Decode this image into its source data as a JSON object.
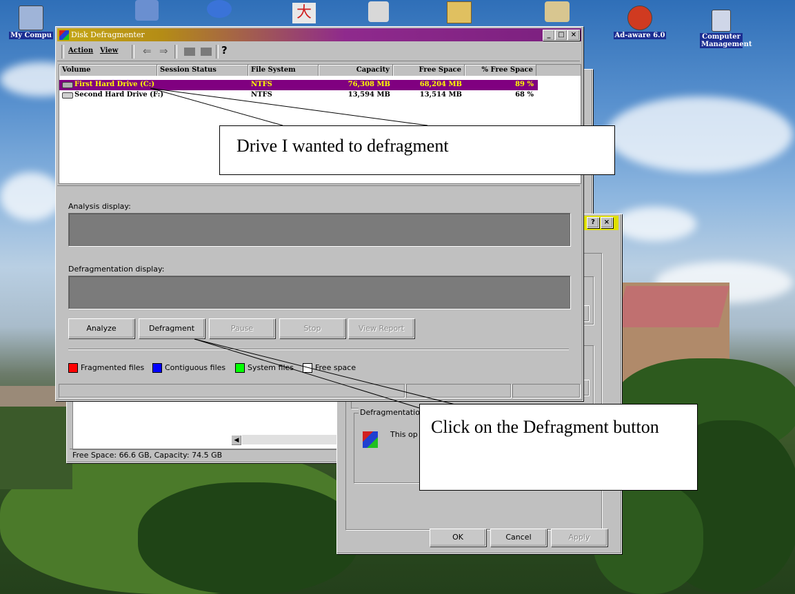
{
  "desktop": {
    "icons": [
      {
        "name": "my-computer",
        "label": "My Compu"
      },
      {
        "name": "ad-aware",
        "label": "Ad-aware 6.0"
      },
      {
        "name": "computer-management",
        "label": "Computer Management"
      }
    ]
  },
  "defrag_window": {
    "title": "Disk Defragmenter",
    "menu": {
      "action": "Action",
      "view": "View"
    },
    "columns": [
      "Volume",
      "Session Status",
      "File System",
      "Capacity",
      "Free Space",
      "% Free Space"
    ],
    "rows": [
      {
        "volume": "First Hard Drive (C:)",
        "status": "",
        "fs": "NTFS",
        "capacity": "76,308 MB",
        "free": "68,204 MB",
        "pct": "89 %"
      },
      {
        "volume": "Second Hard Drive (F:)",
        "status": "",
        "fs": "NTFS",
        "capacity": "13,594 MB",
        "free": "13,514 MB",
        "pct": "68 %"
      }
    ],
    "analysis_label": "Analysis display:",
    "defrag_label": "Defragmentation display:",
    "buttons": {
      "analyze": "Analyze",
      "defragment": "Defragment",
      "pause": "Pause",
      "stop": "Stop",
      "view_report": "View Report"
    },
    "legend": {
      "fragmented": "Fragmented files",
      "contiguous": "Contiguous files",
      "system": "System files",
      "free": "Free space"
    },
    "colors": {
      "fragmented": "#ff0000",
      "contiguous": "#0000ff",
      "system": "#00ff00",
      "free": "#ffffff"
    }
  },
  "properties_window": {
    "status_text": "Free Space: 66.6 GB, Capacity: 74.5 GB",
    "group_title": "Defragmentation",
    "group_text": "This op",
    "buttons": {
      "ok": "OK",
      "cancel": "Cancel",
      "apply": "Apply"
    }
  },
  "callouts": {
    "drive": "Drive I wanted to defragment",
    "button": "Click on the Defragment button"
  }
}
